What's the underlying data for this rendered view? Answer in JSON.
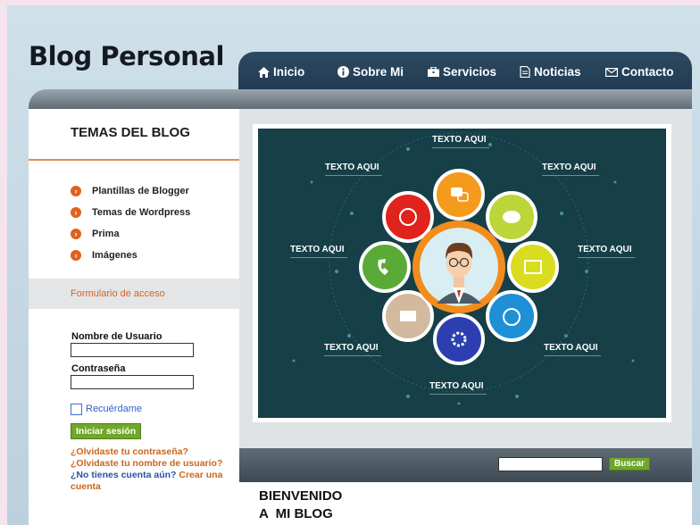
{
  "site": {
    "title": "Blog Personal"
  },
  "nav": [
    {
      "label": "Inicio",
      "icon": "home-icon"
    },
    {
      "label": "Sobre Mi",
      "icon": "info-icon"
    },
    {
      "label": "Servicios",
      "icon": "briefcase-icon"
    },
    {
      "label": "Noticias",
      "icon": "document-icon"
    },
    {
      "label": "Contacto",
      "icon": "mail-icon"
    }
  ],
  "sidebar": {
    "heading": "TEMAS DEL BLOG",
    "topics": [
      "Plantillas de Blogger",
      "Temas de Wordpress",
      "Prima",
      "Imágenes"
    ],
    "form": {
      "heading": "Formulario de acceso",
      "username_label": "Nombre de Usuario",
      "password_label": "Contraseña",
      "remember_label": "Recuérdame",
      "login_button": "Iniciar sesión",
      "forgot_password": "¿Olvidaste tu contraseña?",
      "forgot_username": "¿Olvidaste tu nombre de usuario?",
      "no_account": "¿No tienes cuenta aún?",
      "create_account": "Crear una cuenta"
    }
  },
  "infographic": {
    "labels": [
      "TEXTO AQUI",
      "TEXTO AQUI",
      "TEXTO AQUI",
      "TEXTO AQUI",
      "TEXTO AQUI",
      "TEXTO AQUI",
      "TEXTO AQUI",
      "TEXTO AQUI"
    ],
    "icons": [
      "chat-icon",
      "speech-bubble-icon",
      "map-icon",
      "alarm-clock-icon",
      "settings-icon",
      "envelope-icon",
      "phone-icon",
      "user-exchange-icon"
    ],
    "colors": {
      "background": "#163f48",
      "ring": "#f28c1c"
    }
  },
  "search": {
    "placeholder": "",
    "button": "Buscar"
  },
  "welcome": {
    "line1": "BIENVENIDO",
    "line2": "A  MI BLOG"
  },
  "colors": {
    "accent": "#e0611e",
    "button": "#6fa82a",
    "nav": "#25415a"
  }
}
